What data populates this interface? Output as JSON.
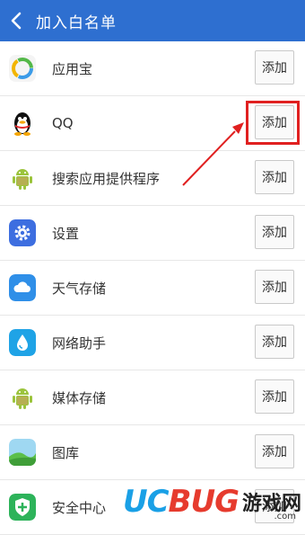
{
  "header": {
    "title": "加入白名单",
    "back_icon": "chevron-left-icon",
    "bg": "#2e6fd0"
  },
  "button_label": "添加",
  "apps": [
    {
      "name": "应用宝",
      "icon": "app-store-icon"
    },
    {
      "name": "QQ",
      "icon": "qq-penguin-icon"
    },
    {
      "name": "搜索应用提供程序",
      "icon": "android-icon"
    },
    {
      "name": "设置",
      "icon": "gear-icon"
    },
    {
      "name": "天气存储",
      "icon": "cloud-icon"
    },
    {
      "name": "网络助手",
      "icon": "water-drop-icon"
    },
    {
      "name": "媒体存储",
      "icon": "android-icon"
    },
    {
      "name": "图库",
      "icon": "gallery-icon"
    },
    {
      "name": "安全中心",
      "icon": "shield-icon"
    }
  ],
  "annotation": {
    "color": "#e02020"
  },
  "watermark": {
    "uc": "UC",
    "bug": "BUG",
    "cn": "游戏网",
    "sub": ".com"
  }
}
